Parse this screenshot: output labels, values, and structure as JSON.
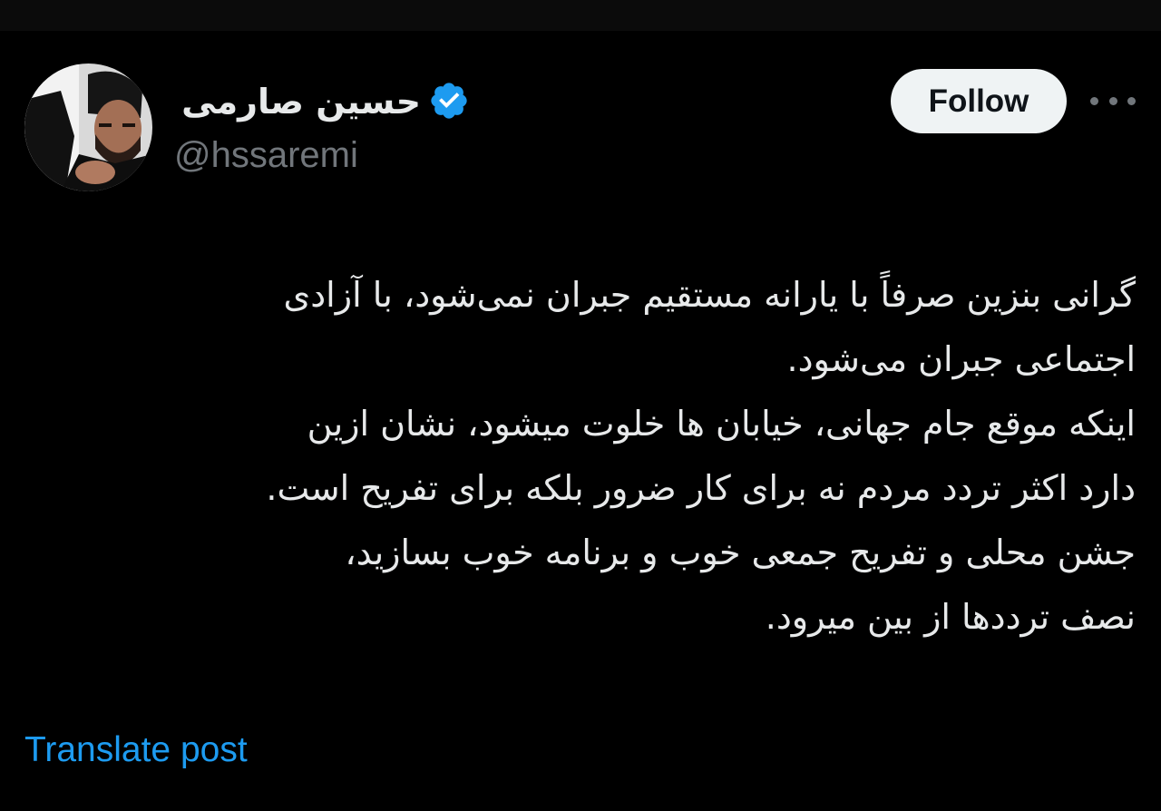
{
  "colors": {
    "background": "#000000",
    "text_primary": "#e7e9ea",
    "text_secondary": "#71767b",
    "accent": "#1d9bf0",
    "follow_button_bg": "#eff3f4",
    "follow_button_text": "#0f1419"
  },
  "author": {
    "display_name": "حسین صارمی",
    "handle": "@hssaremi",
    "verified_icon": "verified-badge-icon",
    "avatar_icon": "avatar"
  },
  "actions": {
    "follow_label": "Follow",
    "more_icon": "more-options-icon"
  },
  "post": {
    "lines": [
      "گرانی بنزین صرفاً با یارانه مستقیم جبران نمی‌شود، با آزادی",
      "اجتماعی جبران می‌شود.",
      "اینکه موقع جام جهانی، خیابان ها خلوت میشود، نشان ازین",
      "دارد اکثر تردد مردم نه برای کار ضرور بلکه برای تفریح است.",
      "جشن محلی و تفریح جمعی خوب و برنامه خوب بسازید،",
      "نصف ترددها از بین میرود."
    ]
  },
  "footer": {
    "translate_label": "Translate post"
  }
}
